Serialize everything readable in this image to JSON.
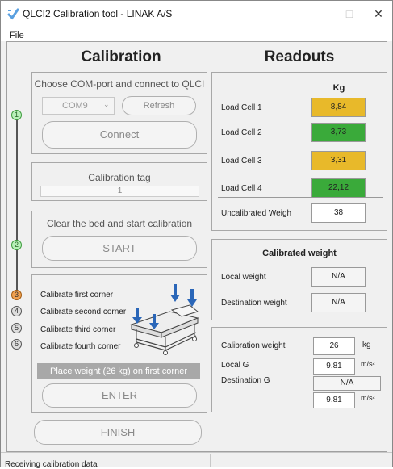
{
  "window": {
    "title": "QLCI2 Calibration tool - LINAK A/S",
    "minimize": "–",
    "maximize": "□",
    "close": "✕"
  },
  "menu": {
    "file": "File"
  },
  "calibration": {
    "heading": "Calibration",
    "com": {
      "title": "Choose COM-port and connect to QLCI",
      "port": "COM9",
      "refresh": "Refresh",
      "connect": "Connect"
    },
    "tag": {
      "title": "Calibration tag",
      "value": "1"
    },
    "start": {
      "title": "Clear the bed and start calibration",
      "button": "START"
    },
    "corners": {
      "items": [
        "Calibrate first corner",
        "Calibrate second corner",
        "Calibrate third corner",
        "Calibrate fourth corner"
      ],
      "message": "Place weight (26 kg) on first corner",
      "enter": "ENTER"
    },
    "finish": "FINISH",
    "steps": [
      "1",
      "2",
      "3",
      "4",
      "5",
      "6"
    ]
  },
  "readouts": {
    "heading": "Readouts",
    "unit": "Kg",
    "cells": [
      {
        "label": "Load Cell 1",
        "value": "8,84",
        "color": "#e8b92a"
      },
      {
        "label": "Load Cell 2",
        "value": "3,73",
        "color": "#3aaa3a"
      },
      {
        "label": "Load Cell 3",
        "value": "3,31",
        "color": "#e8b92a"
      },
      {
        "label": "Load Cell 4",
        "value": "22,12",
        "color": "#3aaa3a"
      }
    ],
    "uncal": {
      "label": "Uncalibrated Weigh",
      "value": "38"
    },
    "calibrated": {
      "title": "Calibrated weight",
      "local_label": "Local weight",
      "local_value": "N/A",
      "dest_label": "Destination weight",
      "dest_value": "N/A"
    },
    "settings": {
      "cal_weight_label": "Calibration weight",
      "cal_weight_value": "26",
      "cal_weight_unit": "kg",
      "local_g_label": "Local G",
      "local_g_value": "9.81",
      "g_unit": "m/s²",
      "dest_g_label": "Destination G",
      "dest_g_na": "N/A",
      "dest_g_value": "9.81"
    }
  },
  "status": {
    "text": "Receiving calibration data"
  }
}
